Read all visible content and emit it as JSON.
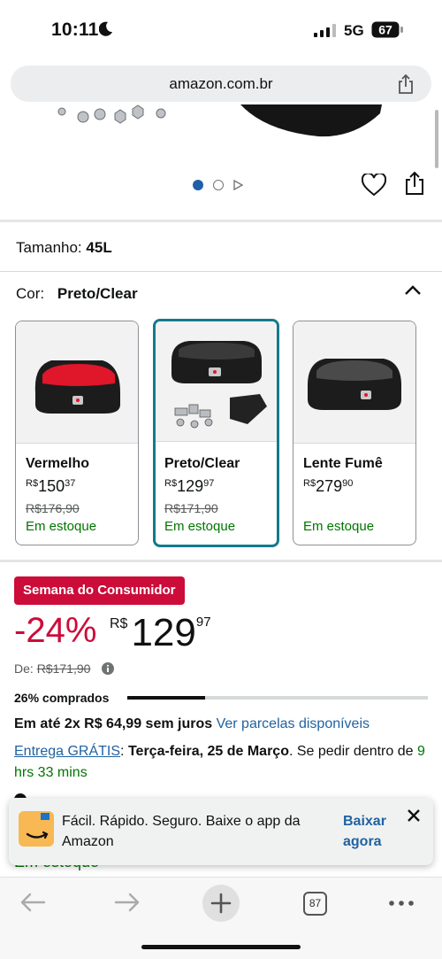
{
  "status_bar": {
    "time": "10:11",
    "network": "5G",
    "battery": "67"
  },
  "browser": {
    "url": "amazon.com.br",
    "tab_count": "87"
  },
  "product": {
    "size_label": "Tamanho:",
    "size_value": "45L",
    "color_label": "Cor:",
    "color_value": "Preto/Clear",
    "variants": [
      {
        "name": "Vermelho",
        "currency": "R$",
        "price_whole": "150",
        "price_cents": "37",
        "old_price": "R$176,90",
        "stock": "Em estoque"
      },
      {
        "name": "Preto/Clear",
        "currency": "R$",
        "price_whole": "129",
        "price_cents": "97",
        "old_price": "R$171,90",
        "stock": "Em estoque"
      },
      {
        "name": "Lente Fumê",
        "currency": "R$",
        "price_whole": "279",
        "price_cents": "90",
        "old_price": "",
        "stock": "Em estoque"
      }
    ]
  },
  "deal": {
    "badge": "Semana do Consumidor",
    "discount": "-24%",
    "currency": "R$",
    "price_whole": "129",
    "price_cents": "97",
    "list_label": "De:",
    "list_price": "R$171,90",
    "bought_text": "26% comprados",
    "bought_fraction": 0.26
  },
  "installments": {
    "bold": "Em até 2x R$ 64,99 sem juros",
    "link": "Ver parcelas disponíveis"
  },
  "delivery": {
    "link": "Entrega GRÁTIS",
    "colon": ":",
    "date": "Terça-feira, 25 de Março",
    "rest": ". Se pedir dentro de",
    "countdown": "9 hrs 33 mins"
  },
  "peek_text": "Em estoque",
  "app_banner": {
    "text": "Fácil. Rápido. Seguro. Baixe o app da Amazon",
    "cta": "Baixar agora"
  },
  "colors": {
    "accent_red": "#cc0c39",
    "selected_border": "#137a8c",
    "link": "#2162a1",
    "stock_green": "#007600"
  }
}
